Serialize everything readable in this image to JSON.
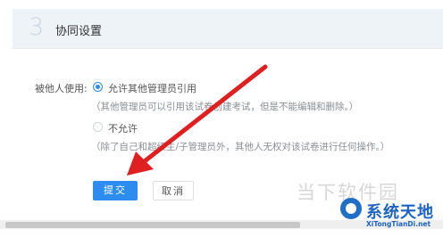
{
  "section": {
    "number": "3",
    "title": "协同设置"
  },
  "usage": {
    "label": "被他人使用:",
    "options": [
      {
        "label": "允许其他管理员引用",
        "hint": "（其他管理员可以引用该试卷创建考试，但是不能编辑和删除。）",
        "checked": true
      },
      {
        "label": "不允许",
        "hint": "（除了自己和超级主/子管理员外，其他人无权对该试卷进行任何操作。）",
        "checked": false
      }
    ]
  },
  "actions": {
    "submit_label": "提交",
    "cancel_label": "取消"
  },
  "watermark": {
    "site_name": "当下软件园",
    "brand_name": "系统天地",
    "brand_url": "XiTongTianDi.net"
  },
  "colors": {
    "accent": "#2d8cf0",
    "arrow": "#e02020",
    "header_bg": "#eef3f8"
  }
}
